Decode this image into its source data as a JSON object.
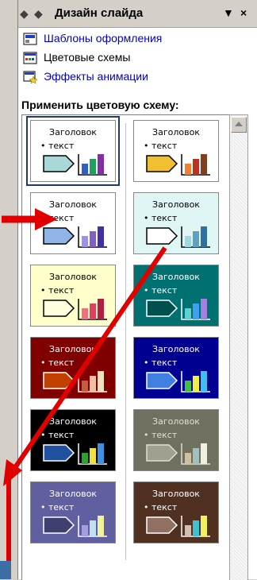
{
  "panel": {
    "title": "Дизайн слайда",
    "close_label": "×",
    "menu_label": "▼"
  },
  "links": [
    {
      "label": "Шаблоны оформления",
      "icon": "design-templates-icon",
      "link": true
    },
    {
      "label": "Цветовые схемы",
      "icon": "color-schemes-icon",
      "link": false
    },
    {
      "label": "Эффекты анимации",
      "icon": "animation-effects-icon",
      "link": true
    }
  ],
  "section_label": "Применить цветовую схему:",
  "schemes": [
    {
      "heading": "Заголовок",
      "text": "• текст",
      "bg": "#ffffff",
      "fg": "#000000",
      "shape": "#a8d8d8",
      "bars": [
        "#3060c0",
        "#20a060",
        "#8030a0"
      ]
    },
    {
      "heading": "Заголовок",
      "text": "• текст",
      "bg": "#ffffff",
      "fg": "#000000",
      "shape": "#f0c030",
      "bars": [
        "#f08030",
        "#c03020",
        "#804020"
      ]
    },
    {
      "heading": "Заголовок",
      "text": "• текст",
      "bg": "#ffffff",
      "fg": "#000000",
      "shape": "#8eb4e8",
      "bars": [
        "#a090e0",
        "#8060c0",
        "#4030a0"
      ]
    },
    {
      "heading": "Заголовок",
      "text": "• текст",
      "bg": "#e0f6f4",
      "fg": "#000000",
      "shape": "#ffffff",
      "bars": [
        "#a0d8e0",
        "#60a0c0",
        "#3070a0"
      ]
    },
    {
      "heading": "Заголовок",
      "text": "• текст",
      "bg": "#ffffcc",
      "fg": "#000000",
      "shape": "#ffffe0",
      "bars": [
        "#f07080",
        "#e04060",
        "#b02040"
      ]
    },
    {
      "heading": "Заголовок",
      "text": "• текст",
      "bg": "#007070",
      "fg": "#ffffff",
      "shape": "#005050",
      "bars": [
        "#60d0d0",
        "#40a0f0",
        "#a080e0"
      ]
    },
    {
      "heading": "Заголовок",
      "text": "• текст",
      "bg": "#800000",
      "fg": "#ffffff",
      "shape": "#c04000",
      "bars": [
        "#c06040",
        "#f0c0a0",
        "#f0e0c0"
      ]
    },
    {
      "heading": "Заголовок",
      "text": "• текст",
      "bg": "#000090",
      "fg": "#ffffff",
      "shape": "#4080e0",
      "bars": [
        "#40c040",
        "#f0f040",
        "#40c0f0"
      ]
    },
    {
      "heading": "Заголовок",
      "text": "• текст",
      "bg": "#000000",
      "fg": "#ffffff",
      "shape": "#2050a0",
      "bars": [
        "#30a030",
        "#f0e040",
        "#4090e0"
      ]
    },
    {
      "heading": "Заголовок",
      "text": "• текст",
      "bg": "#707060",
      "fg": "#e0e0d0",
      "shape": "#a0a090",
      "bars": [
        "#d0c0a0",
        "#a0c0c0",
        "#f0f0e0"
      ]
    },
    {
      "heading": "Заголовок",
      "text": "• текст",
      "bg": "#6060a0",
      "fg": "#ffffff",
      "shape": "#404070",
      "bars": [
        "#a0a0e0",
        "#c0e0f0",
        "#f0f0a0"
      ]
    },
    {
      "heading": "Заголовок",
      "text": "• текст",
      "bg": "#503020",
      "fg": "#ffffff",
      "shape": "#907060",
      "bars": [
        "#d0c0b0",
        "#40c0d0",
        "#f0f060"
      ]
    }
  ]
}
